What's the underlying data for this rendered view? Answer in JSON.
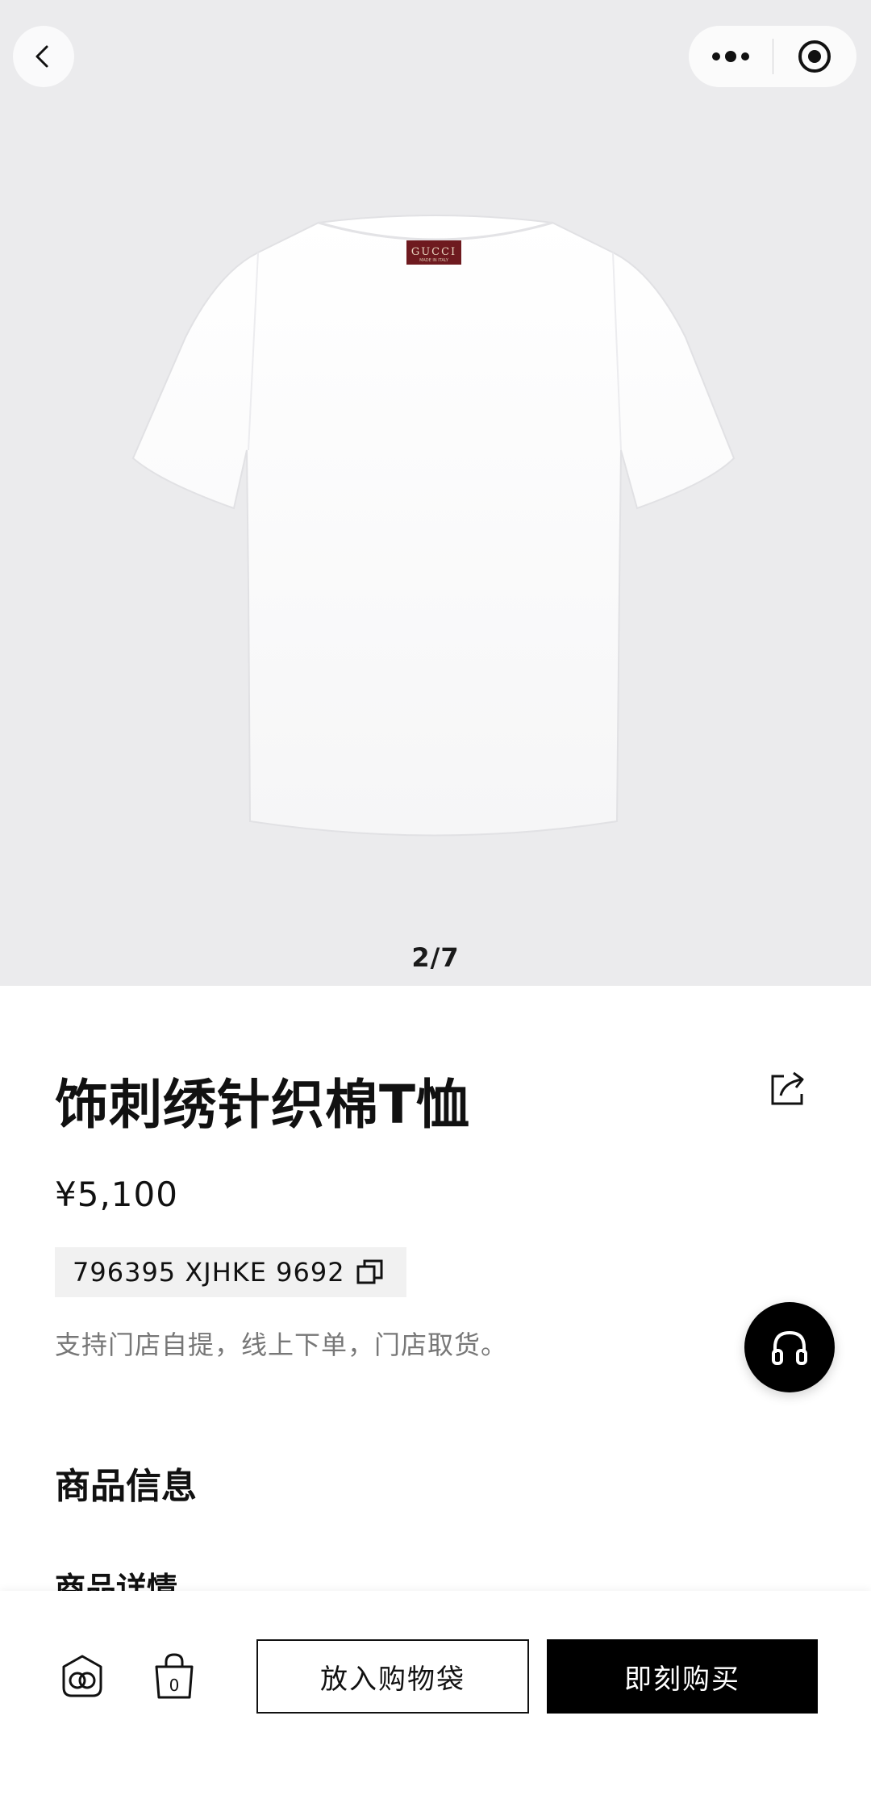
{
  "gallery": {
    "counter": "2/7"
  },
  "product": {
    "title": "饰刺绣针织棉T恤",
    "price": "¥5,100",
    "sku": "796395 XJHKE 9692",
    "pickup_note": "支持门店自提，线上下单，门店取货。",
    "label_brand": "GUCCI",
    "label_origin": "MADE IN ITALY"
  },
  "sections": {
    "info_title": "商品信息",
    "detail_title": "商品详情"
  },
  "bottom_bar": {
    "cart_count": "0",
    "add_to_bag_label": "放入购物袋",
    "buy_now_label": "即刻购买"
  },
  "icons": {
    "back": "chevron-left-icon",
    "more": "more-dots-icon",
    "target": "target-icon",
    "share": "share-icon",
    "copy": "copy-icon",
    "service": "headphones-icon",
    "brand_home": "gg-logo-icon",
    "bag": "shopping-bag-icon"
  },
  "colors": {
    "accent": "#000000",
    "label_red": "#6e1a1f",
    "gallery_bg": "#ebebed"
  }
}
